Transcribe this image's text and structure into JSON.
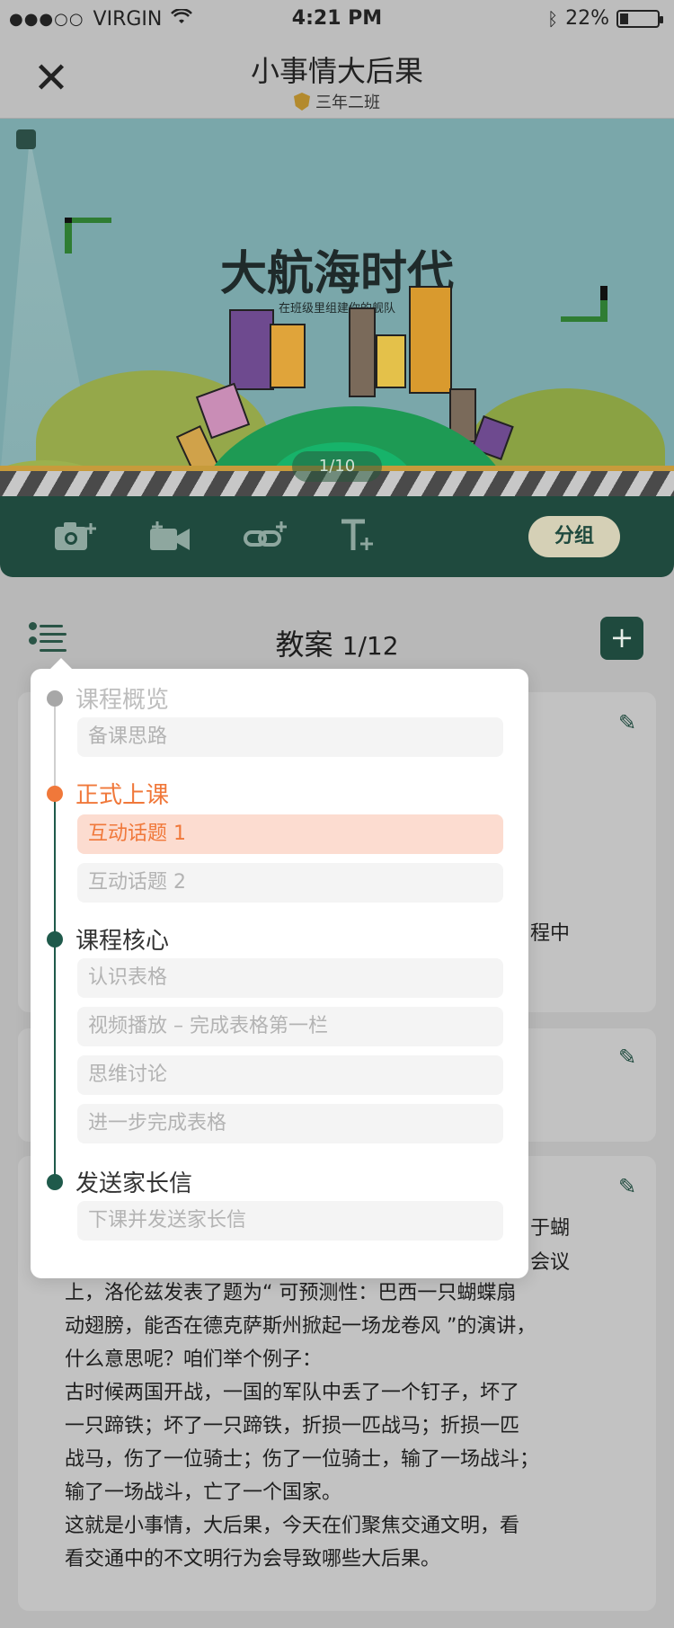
{
  "status_bar": {
    "signal": "●●●○○",
    "carrier": "VIRGIN",
    "time": "4:21 PM",
    "battery": "22%",
    "battery_level": 0.22
  },
  "header": {
    "title": "小事情大后果",
    "subtitle": "三年二班"
  },
  "banner": {
    "heading": "大航海时代",
    "tagline": "在班级里组建你的舰队",
    "pager": "1/10"
  },
  "toolbar": {
    "group_label": "分组",
    "icons": [
      "camera-plus-icon",
      "video-plus-icon",
      "link-plus-icon",
      "text-plus-icon"
    ]
  },
  "plan": {
    "title": "教案",
    "count": "1/12"
  },
  "outline": {
    "sections": [
      {
        "title": "课程概览",
        "items": [
          "备课思路"
        ]
      },
      {
        "title": "正式上课",
        "items": [
          "互动话题 1",
          "互动话题 2"
        ]
      },
      {
        "title": "课程核心",
        "items": [
          "认识表格",
          "视频播放 – 完成表格第一栏",
          "思维讨论",
          "进一步完成表格"
        ]
      },
      {
        "title": "发送家长信",
        "items": [
          "下课并发送家长信"
        ]
      }
    ]
  },
  "behind": {
    "card1_fragment": "程中",
    "card3_fragments": [
      "于蝴",
      "会议"
    ],
    "card3_paragraph_lines": [
      "上，洛伦兹发表了题为“ 可预测性：巴西一只蝴蝶扇",
      "动翅膀，能否在德克萨斯州掀起一场龙卷风 ”的演讲，",
      "什么意思呢？咱们举个例子：",
      "古时候两国开战，一国的军队中丢了一个钉子，坏了",
      "一只蹄铁；坏了一只蹄铁，折损一匹战马；折损一匹",
      "战马，伤了一位骑士；伤了一位骑士，输了一场战斗；",
      "输了一场战斗，亡了一个国家。",
      "这就是小事情，大后果，今天在们聚焦交通文明，看",
      "看交通中的不文明行为会导致哪些大后果。"
    ]
  },
  "colors": {
    "accent": "#1f4a3e",
    "active": "#f0783a",
    "active_bg": "#fcdcd0"
  }
}
